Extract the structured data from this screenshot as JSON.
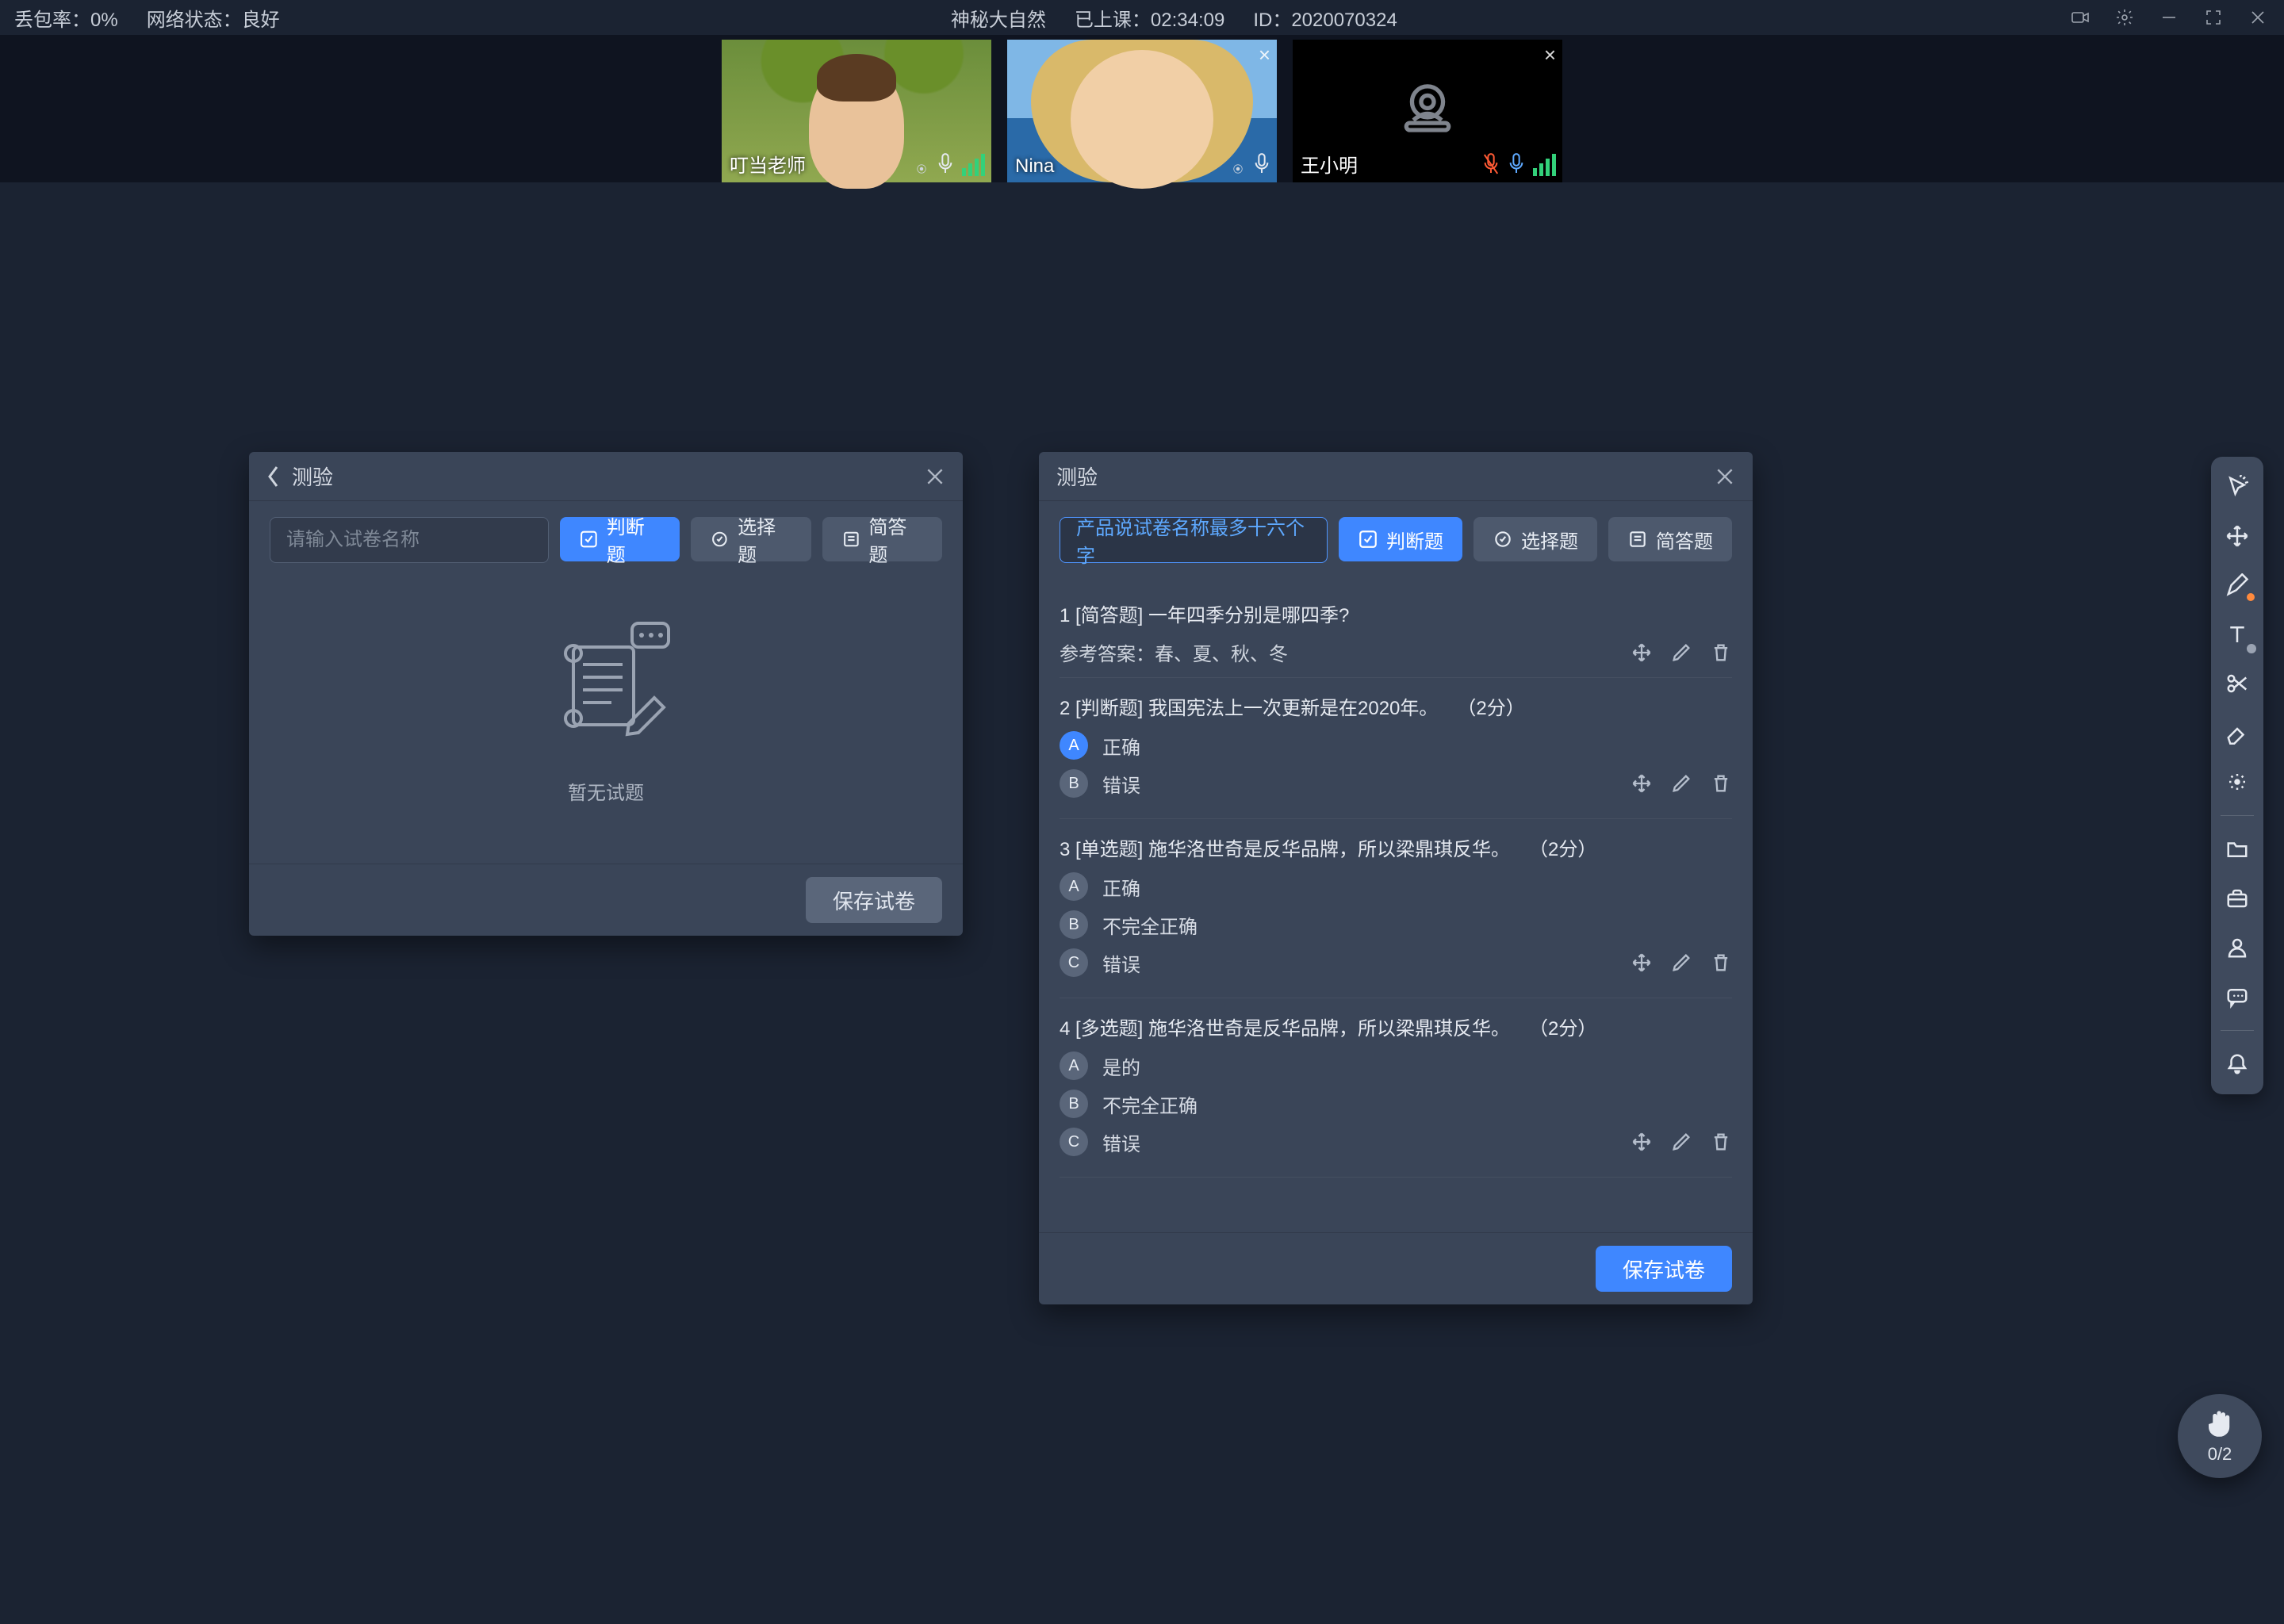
{
  "status": {
    "drop_rate_label": "丢包率：",
    "drop_rate_value": "0%",
    "net_label": "网络状态：",
    "net_value": "良好",
    "course_title": "神秘大自然",
    "elapsed_label": "已上课：",
    "elapsed_value": "02:34:09",
    "session_id_label": "ID：",
    "session_id_value": "2020070324"
  },
  "videos": [
    {
      "name": "叮当老师",
      "mic_muted": false,
      "camera_on": true,
      "closeable": false
    },
    {
      "name": "Nina",
      "mic_muted": false,
      "camera_on": true,
      "closeable": true
    },
    {
      "name": "王小明",
      "mic_muted": true,
      "camera_on": false,
      "closeable": true
    }
  ],
  "panels": {
    "empty": {
      "title": "测验",
      "name_placeholder": "请输入试卷名称",
      "buttons": {
        "judge": "判断题",
        "choice": "选择题",
        "short": "简答题"
      },
      "empty_text": "暂无试题",
      "save": "保存试卷"
    },
    "full": {
      "title": "测验",
      "name_value": "产品说试卷名称最多十六个字",
      "buttons": {
        "judge": "判断题",
        "choice": "选择题",
        "short": "简答题"
      },
      "save": "保存试卷",
      "answer_prefix": "参考答案：",
      "questions": [
        {
          "num": "1",
          "type": "简答题",
          "text": "一年四季分别是哪四季?",
          "ref_answer": "春、夏、秋、冬"
        },
        {
          "num": "2",
          "type": "判断题",
          "text": "我国宪法上一次更新是在2020年。",
          "score": "（2分）",
          "options": [
            {
              "letter": "A",
              "label": "正确",
              "selected": true
            },
            {
              "letter": "B",
              "label": "错误",
              "selected": false
            }
          ]
        },
        {
          "num": "3",
          "type": "单选题",
          "text": "施华洛世奇是反华品牌，所以梁鼎琪反华。",
          "score": "（2分）",
          "options": [
            {
              "letter": "A",
              "label": "正确",
              "selected": false
            },
            {
              "letter": "B",
              "label": "不完全正确",
              "selected": false
            },
            {
              "letter": "C",
              "label": "错误",
              "selected": false
            }
          ]
        },
        {
          "num": "4",
          "type": "多选题",
          "text": "施华洛世奇是反华品牌，所以梁鼎琪反华。",
          "score": "（2分）",
          "options": [
            {
              "letter": "A",
              "label": "是的",
              "selected": false
            },
            {
              "letter": "B",
              "label": "不完全正确",
              "selected": false
            },
            {
              "letter": "C",
              "label": "错误",
              "selected": false
            }
          ]
        }
      ]
    }
  },
  "hand_raise_count": "0/2"
}
